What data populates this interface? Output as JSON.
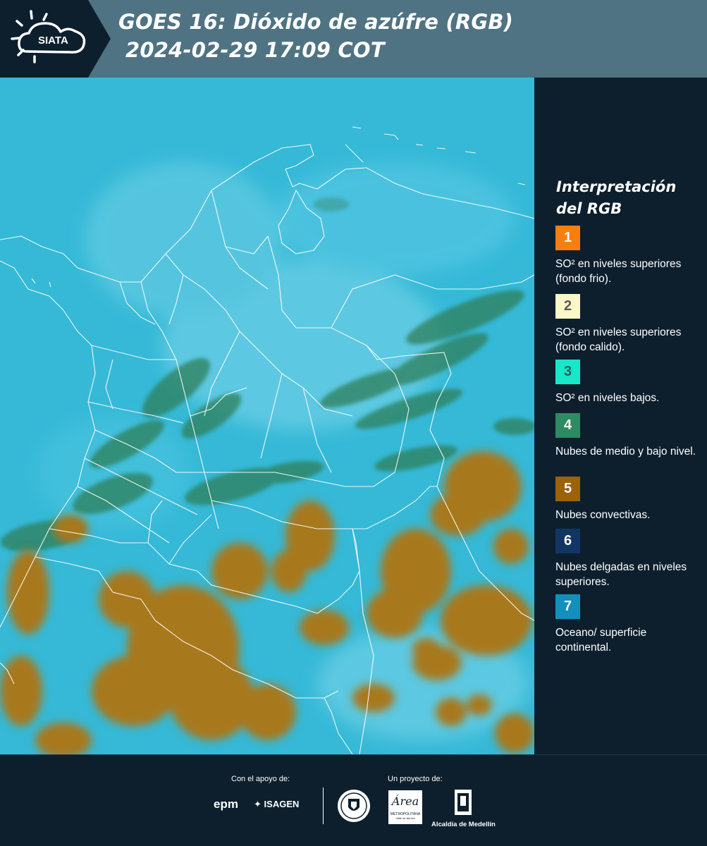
{
  "header": {
    "logo_text": "SIATA",
    "title": "GOES 16: Dióxido de azúfre (RGB)",
    "subtitle": "2024-02-29 17:09 COT",
    "background_color": "#4f7382"
  },
  "legend": {
    "title_line_1": "Interpretación",
    "title_line_2": "del RGB",
    "items": [
      {
        "number": "1",
        "color": "#f77f10",
        "number_color": "#ffffff",
        "text": "SO² en niveles superiores (fondo frio)."
      },
      {
        "number": "2",
        "color": "#fcf7c6",
        "number_color": "#5a5a5a",
        "text": "SO² en niveles superiores (fondo calido)."
      },
      {
        "number": "3",
        "color": "#17e8c8",
        "number_color": "#2e5e5a",
        "text": "SO² en niveles bajos."
      },
      {
        "number": "4",
        "color": "#2e8a62",
        "number_color": "#ffffff",
        "text": "Nubes de medio y bajo nivel."
      },
      {
        "number": "5",
        "color": "#9a6209",
        "number_color": "#ffffff",
        "text": "Nubes convectivas."
      },
      {
        "number": "6",
        "color": "#113663",
        "number_color": "#ffffff",
        "text": "Nubes delgadas en niveles superiores."
      },
      {
        "number": "7",
        "color": "#138fbc",
        "number_color": "#ffffff",
        "text": "Oceano/ superficie continental."
      }
    ]
  },
  "map": {
    "description_colors": {
      "background": "#35b9d7",
      "convective": "#a8781c",
      "midlevel": "#2f7f5a",
      "borders": "#ffffff"
    }
  },
  "footer": {
    "support_label": "Con el apoyo de:",
    "project_label": "Un proyecto de:",
    "partners": {
      "epm": "epm",
      "isagen": "ISAGEN",
      "area_metro": "Área",
      "area_metro_sub": "METROPOLITANA",
      "area_metro_sub2": "Valle de Aburrá",
      "alcaldia": "Alcaldía de Medellín"
    }
  }
}
